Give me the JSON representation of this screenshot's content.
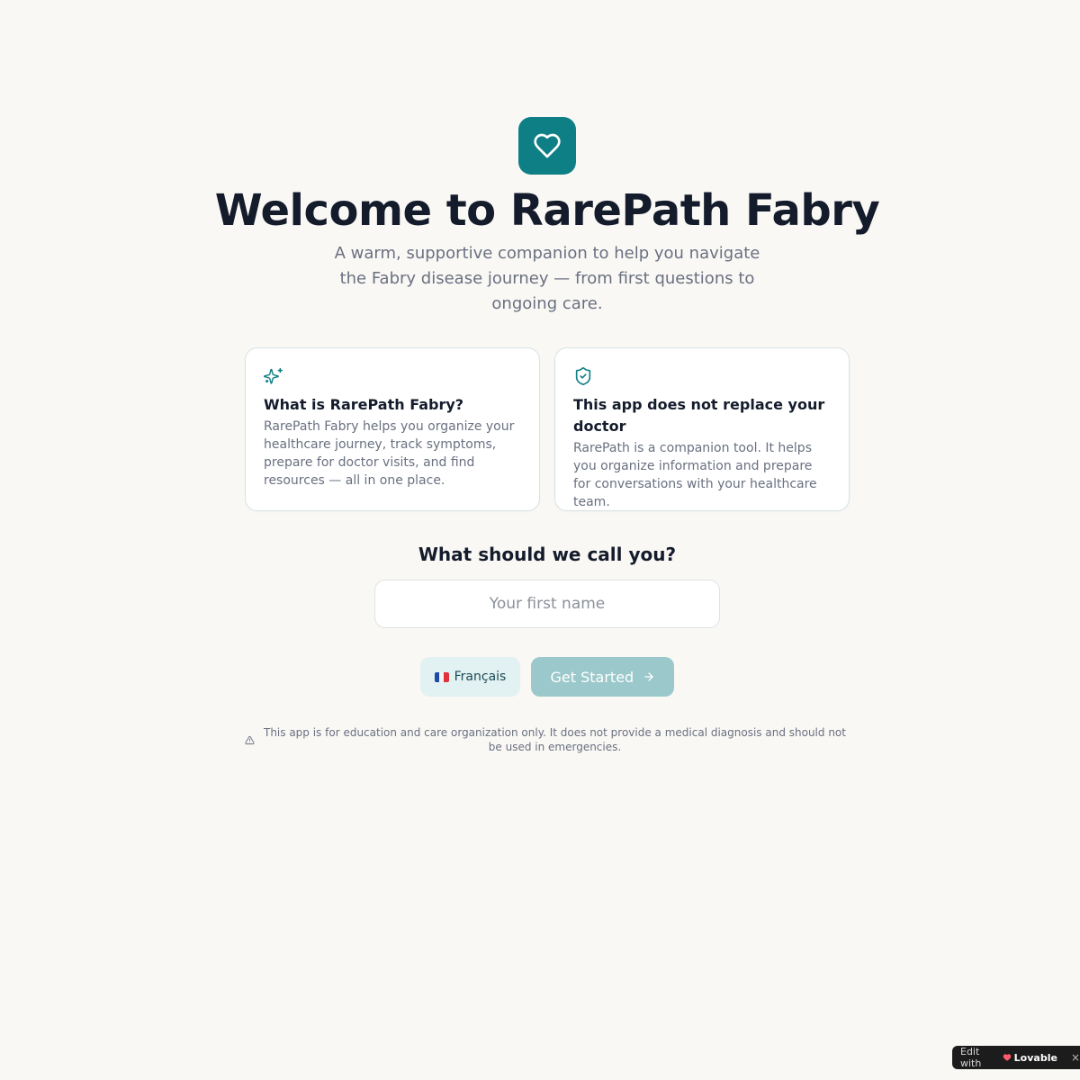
{
  "header": {
    "title": "Welcome to RarePath Fabry",
    "subtitle": "A warm, supportive companion to help you navigate the Fabry disease journey — from first questions to ongoing care.",
    "logo_icon": "heart-icon"
  },
  "cards": [
    {
      "icon": "sparkles-icon",
      "title": "What is RarePath Fabry?",
      "text": "RarePath Fabry helps you organize your healthcare journey, track symptoms, prepare for doctor visits, and find resources — all in one place."
    },
    {
      "icon": "shield-check-icon",
      "title": "This app does not replace your doctor",
      "text": "RarePath is a companion tool. It helps you organize information and prepare for conversations with your healthcare team."
    }
  ],
  "name_form": {
    "question": "What should we call you?",
    "placeholder": "Your first name",
    "value": ""
  },
  "actions": {
    "language_label": "Français",
    "start_label": "Get Started"
  },
  "disclaimer": "This app is for education and care organization only. It does not provide a medical diagnosis and should not be used in emergencies.",
  "badge": {
    "prefix": "Edit with",
    "brand": "Lovable",
    "close": "×"
  },
  "colors": {
    "accent": "#0f7f86",
    "background": "#faf8f5",
    "start_button_disabled": "#9bc8cb",
    "language_button_bg": "#e2f2f3"
  }
}
